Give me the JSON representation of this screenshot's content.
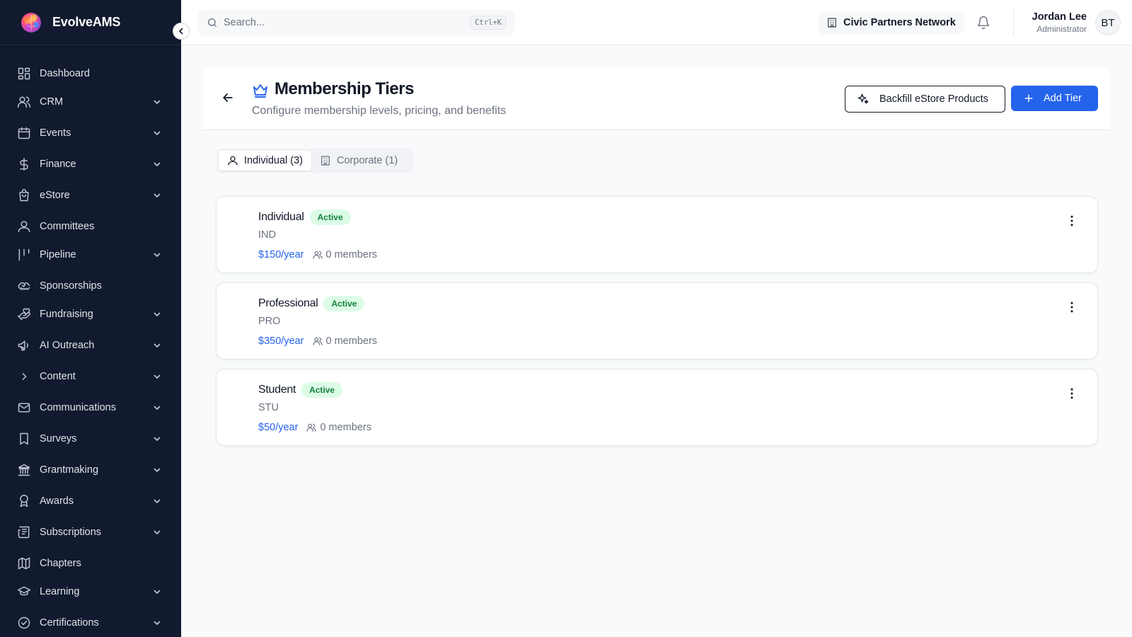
{
  "brand": {
    "name": "EvolveAMS",
    "logo_icon": "brain-logo-icon"
  },
  "sidebar": {
    "items": [
      {
        "label": "Dashboard",
        "icon": "dashboard-icon",
        "expandable": false
      },
      {
        "label": "CRM",
        "icon": "users-icon",
        "expandable": true
      },
      {
        "label": "Events",
        "icon": "calendar-icon",
        "expandable": true
      },
      {
        "label": "Finance",
        "icon": "dollar-icon",
        "expandable": true
      },
      {
        "label": "eStore",
        "icon": "shopping-bag-icon",
        "expandable": true
      },
      {
        "label": "Committees",
        "icon": "user-icon",
        "expandable": false
      },
      {
        "label": "Pipeline",
        "icon": "kanban-icon",
        "expandable": true
      },
      {
        "label": "Sponsorships",
        "icon": "handshake-icon",
        "expandable": false
      },
      {
        "label": "Fundraising",
        "icon": "hand-heart-icon",
        "expandable": true
      },
      {
        "label": "AI Outreach",
        "icon": "megaphone-icon",
        "expandable": true
      },
      {
        "label": "Content",
        "icon": "chevron-right-icon",
        "expandable": true
      },
      {
        "label": "Communications",
        "icon": "mail-icon",
        "expandable": true
      },
      {
        "label": "Surveys",
        "icon": "bookmark-icon",
        "expandable": true
      },
      {
        "label": "Grantmaking",
        "icon": "landmark-icon",
        "expandable": true
      },
      {
        "label": "Awards",
        "icon": "award-icon",
        "expandable": true
      },
      {
        "label": "Subscriptions",
        "icon": "newspaper-icon",
        "expandable": true
      },
      {
        "label": "Chapters",
        "icon": "map-icon",
        "expandable": false
      },
      {
        "label": "Learning",
        "icon": "graduation-cap-icon",
        "expandable": true
      },
      {
        "label": "Certifications",
        "icon": "check-circle-icon",
        "expandable": true
      }
    ]
  },
  "topbar": {
    "search_placeholder": "Search...",
    "search_shortcut": "Ctrl+K",
    "org_name": "Civic Partners Network",
    "user_name": "Jordan Lee",
    "user_role": "Administrator",
    "avatar_initials": "BT"
  },
  "header": {
    "title": "Membership Tiers",
    "subtitle": "Configure membership levels, pricing, and benefits",
    "backfill_label": "Backfill eStore Products",
    "add_label": "Add Tier"
  },
  "tabs": [
    {
      "label": "Individual (3)",
      "active": true,
      "icon": "user-icon"
    },
    {
      "label": "Corporate (1)",
      "active": false,
      "icon": "building-icon"
    }
  ],
  "tiers": [
    {
      "name": "Individual",
      "status": "Active",
      "code": "IND",
      "price": "$150/year",
      "members": "0 members"
    },
    {
      "name": "Professional",
      "status": "Active",
      "code": "PRO",
      "price": "$350/year",
      "members": "0 members"
    },
    {
      "name": "Student",
      "status": "Active",
      "code": "STU",
      "price": "$50/year",
      "members": "0 members"
    }
  ],
  "colors": {
    "sidebar_bg": "#111a2e",
    "accent": "#2563eb",
    "badge_bg": "#dcfce7",
    "badge_text": "#15803d"
  }
}
